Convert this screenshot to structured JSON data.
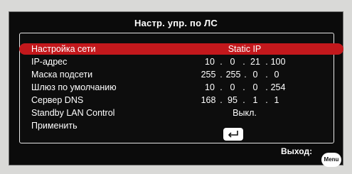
{
  "osd": {
    "title": "Настр. упр. по ЛС"
  },
  "rows": [
    {
      "label": "Настройка сети",
      "value": "Static IP"
    },
    {
      "label": "IP-адрес",
      "ip": [
        "10",
        ".",
        "0",
        ".",
        "21",
        ".",
        "100"
      ]
    },
    {
      "label": "Маска подсети",
      "ip": [
        "255",
        ".",
        "255",
        ".",
        "0",
        ".",
        "0"
      ]
    },
    {
      "label": "Шлюз по умолчанию",
      "ip": [
        "10",
        ".",
        "0",
        ".",
        "0",
        ".",
        "254"
      ]
    },
    {
      "label": "Сервер DNS",
      "ip": [
        "168",
        ".",
        "95",
        ".",
        "1",
        ".",
        "1"
      ]
    },
    {
      "label": "Standby LAN Control",
      "value": "Выкл."
    },
    {
      "label": "Применить",
      "icon": "enter-icon"
    }
  ],
  "footer": {
    "exit_label": "Выход:",
    "menu_badge": "Menu"
  },
  "colors": {
    "selection": "#c3181c",
    "background": "#0b0b0b",
    "text": "#ffffff"
  }
}
